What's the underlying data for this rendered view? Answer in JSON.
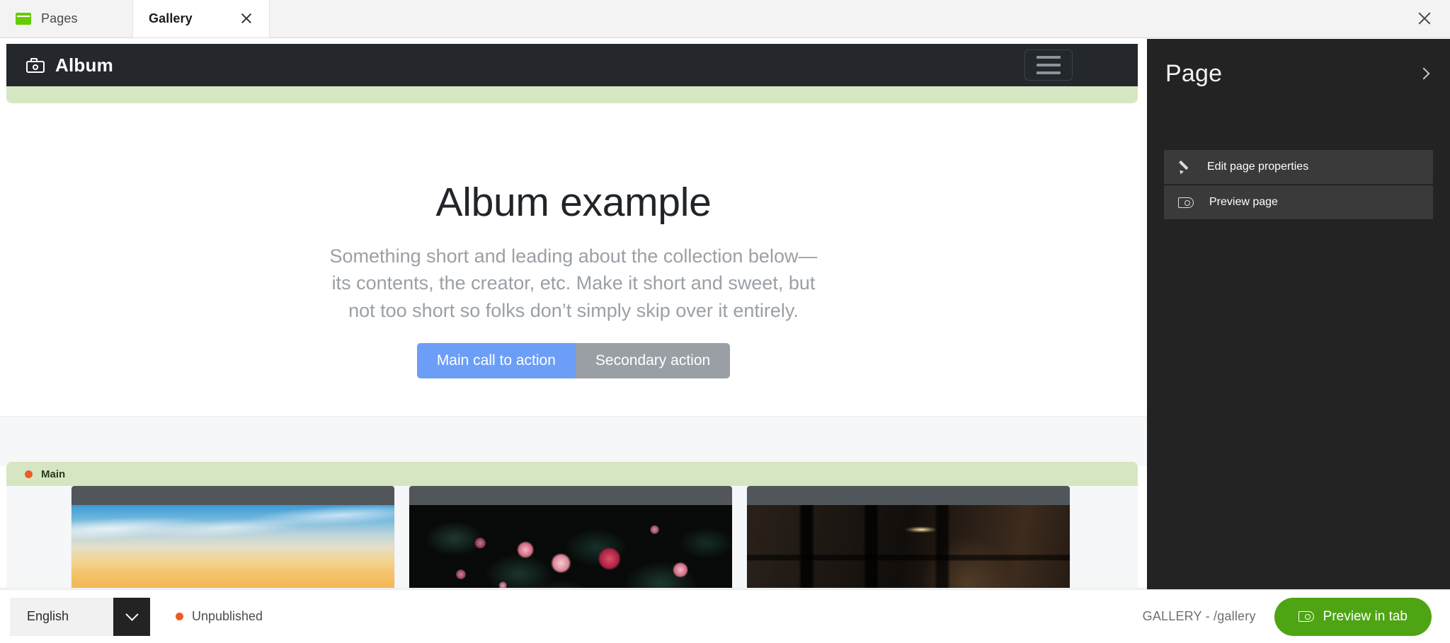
{
  "window": {
    "close_label": "close-window",
    "tabs": [
      {
        "label": "Pages",
        "icon": "pages-icon",
        "active": false,
        "closable": false
      },
      {
        "label": "Gallery",
        "icon": null,
        "active": true,
        "closable": true
      }
    ]
  },
  "canvas": {
    "site_header": {
      "brand": "Album",
      "brand_icon": "camera-icon",
      "menu_icon": "hamburger-icon"
    },
    "hero": {
      "title": "Album example",
      "subtitle": "Something short and leading about the collection below—its contents, the creator, etc. Make it short and sweet, but not too short so folks don’t simply skip over it entirely.",
      "primary_button": "Main call to action",
      "secondary_button": "Secondary action"
    },
    "section": {
      "label": "Main",
      "status_dot_color": "#ef5a24"
    },
    "cards": [
      {
        "name": "sunset-sky-photo"
      },
      {
        "name": "dark-floral-photo"
      },
      {
        "name": "night-building-photo"
      }
    ]
  },
  "side_panel": {
    "title": "Page",
    "collapse_icon": "chevron-right-icon",
    "items": [
      {
        "label": "Edit page properties",
        "icon": "pencil-icon"
      },
      {
        "label": "Preview page",
        "icon": "eye-icon"
      }
    ]
  },
  "status_bar": {
    "language": "English",
    "language_caret": "chevron-down-icon",
    "publish_status": "Unpublished",
    "publish_dot_color": "#ef5a24",
    "page_path": "GALLERY - /gallery",
    "preview_button": "Preview in tab",
    "preview_button_icon": "eye-icon",
    "preview_button_color": "#4ea413"
  }
}
